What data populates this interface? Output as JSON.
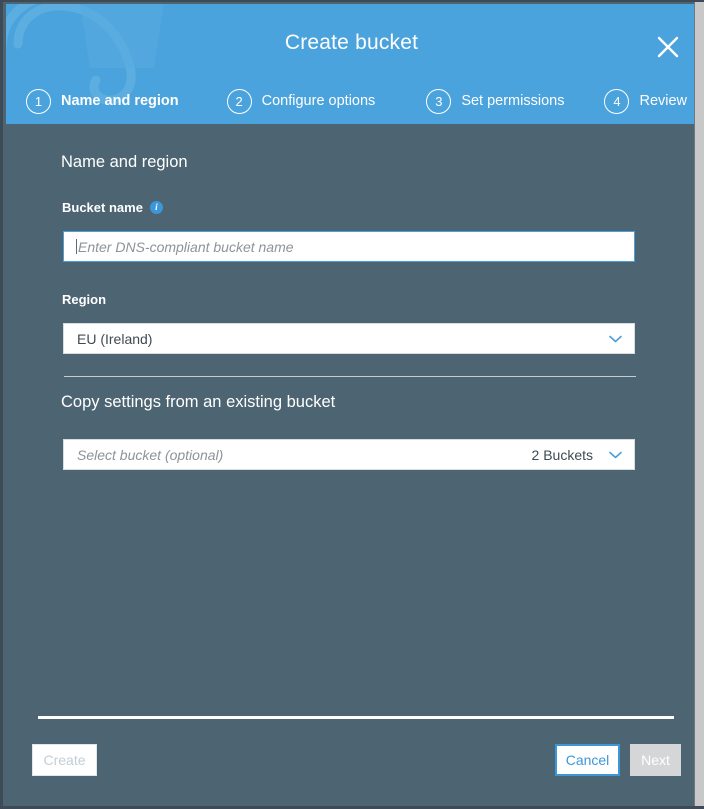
{
  "dialog": {
    "title": "Create bucket",
    "close_icon": "close-icon"
  },
  "steps": [
    {
      "number": "1",
      "label": "Name and region",
      "active": true
    },
    {
      "number": "2",
      "label": "Configure options",
      "active": false
    },
    {
      "number": "3",
      "label": "Set permissions",
      "active": false
    },
    {
      "number": "4",
      "label": "Review",
      "active": false
    }
  ],
  "form": {
    "section_title": "Name and region",
    "bucket_name": {
      "label": "Bucket name",
      "info_icon": "info-icon",
      "info_glyph": "i",
      "placeholder": "Enter DNS-compliant bucket name",
      "value": ""
    },
    "region": {
      "label": "Region",
      "selected": "EU (Ireland)",
      "chevron_icon": "chevron-down-icon"
    },
    "copy_settings": {
      "title": "Copy settings from an existing bucket",
      "placeholder": "Select bucket (optional)",
      "count": "2 Buckets",
      "chevron_icon": "chevron-down-icon"
    }
  },
  "footer": {
    "create_label": "Create",
    "cancel_label": "Cancel",
    "next_label": "Next"
  },
  "colors": {
    "header_blue": "#4aa3dc",
    "body_slate": "#4d6472",
    "accent_blue": "#3c97d9",
    "disabled_gray": "#d4d6d8"
  }
}
